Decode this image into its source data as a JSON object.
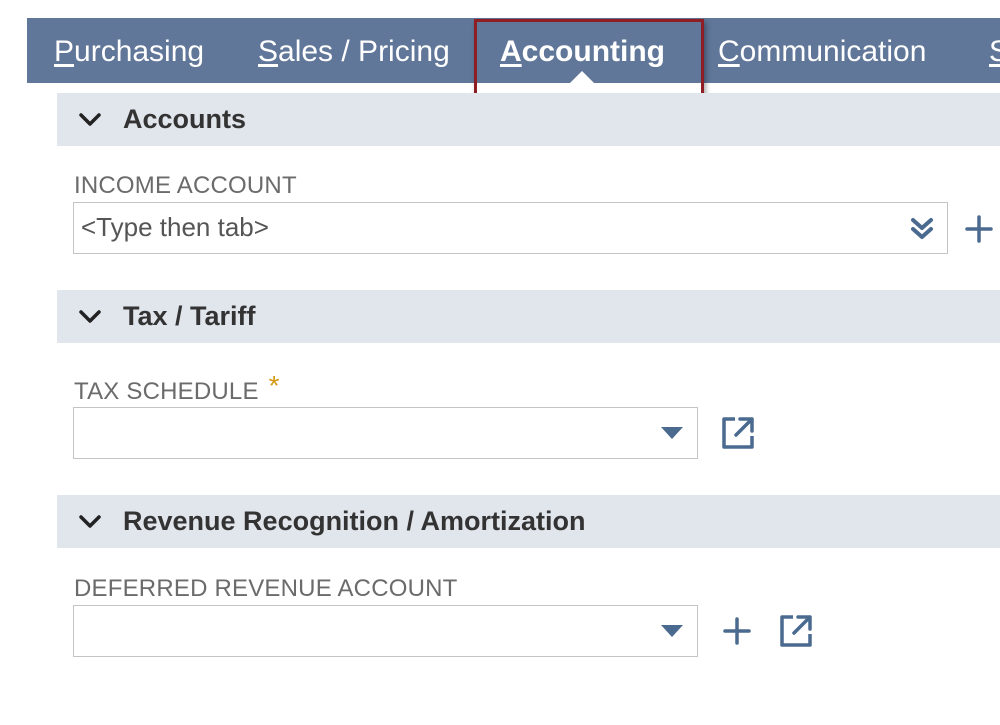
{
  "tabs": [
    {
      "label": "Purchasing",
      "underline_char": "P",
      "rest": "urchasing"
    },
    {
      "label": "Sales / Pricing",
      "underline_char": "S",
      "rest": "ales / Pricing"
    },
    {
      "label": "Accounting",
      "underline_char": "A",
      "rest": "ccounting",
      "active": true
    },
    {
      "label": "Communication",
      "underline_char": "C",
      "rest": "ommunication"
    },
    {
      "label": "S",
      "underline_char": "S",
      "rest": ""
    }
  ],
  "sections": {
    "accounts": {
      "title": "Accounts",
      "income_account": {
        "label": "INCOME ACCOUNT",
        "placeholder": "<Type then tab>",
        "value": ""
      }
    },
    "tax": {
      "title": "Tax / Tariff",
      "tax_schedule": {
        "label": "TAX SCHEDULE",
        "required_mark": "*",
        "value": ""
      }
    },
    "revenue": {
      "title": "Revenue Recognition / Amortization",
      "deferred_revenue_account": {
        "label": "DEFERRED REVENUE ACCOUNT",
        "value": ""
      }
    }
  },
  "colors": {
    "tab_bar": "#607799",
    "section_header": "#e1e5ec",
    "highlight_border": "#8f1d24",
    "required": "#d49a16",
    "icon": "#4a6a8f"
  },
  "icons": {
    "collapse": "chevron-down-icon",
    "list": "double-chevron-down-icon",
    "add": "plus-icon",
    "open": "external-link-icon",
    "dropdown": "caret-down-icon"
  }
}
